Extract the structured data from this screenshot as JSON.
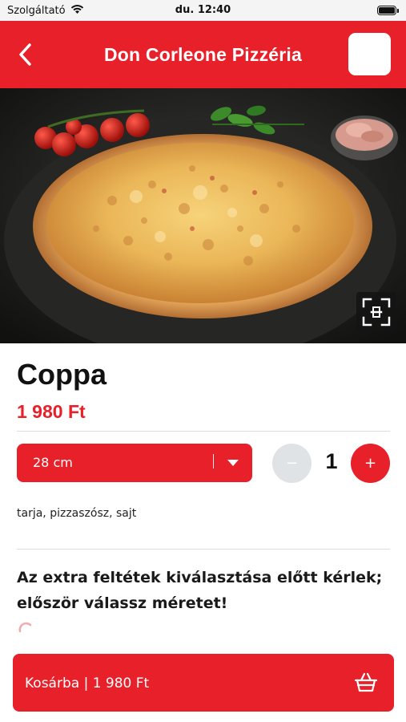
{
  "status_bar": {
    "carrier": "Szolgáltató",
    "time": "du. 12:40"
  },
  "header": {
    "title": "Don Corleone Pizzéria"
  },
  "product": {
    "name": "Coppa",
    "price": "1 980 Ft",
    "ingredients": "tarja, pizzaszósz, sajt"
  },
  "size_selector": {
    "selected": "28 cm",
    "separator": "|"
  },
  "quantity": {
    "value": "1",
    "minus_label": "−",
    "plus_label": "+"
  },
  "extras": {
    "note": "Az extra feltétek kiválasztása előtt kérlek; először válassz méretet!"
  },
  "cart": {
    "label": "Kosárba | 1 980 Ft"
  },
  "colors": {
    "brand_red": "#e8202a",
    "disabled_gray": "#dfe3e6"
  },
  "icons": {
    "back": "chevron-left-icon",
    "wifi": "wifi-icon",
    "battery": "battery-icon",
    "fullscreen": "fullscreen-icon",
    "dropdown": "caret-down-icon",
    "cart": "basket-icon",
    "loading": "spinner-icon"
  }
}
